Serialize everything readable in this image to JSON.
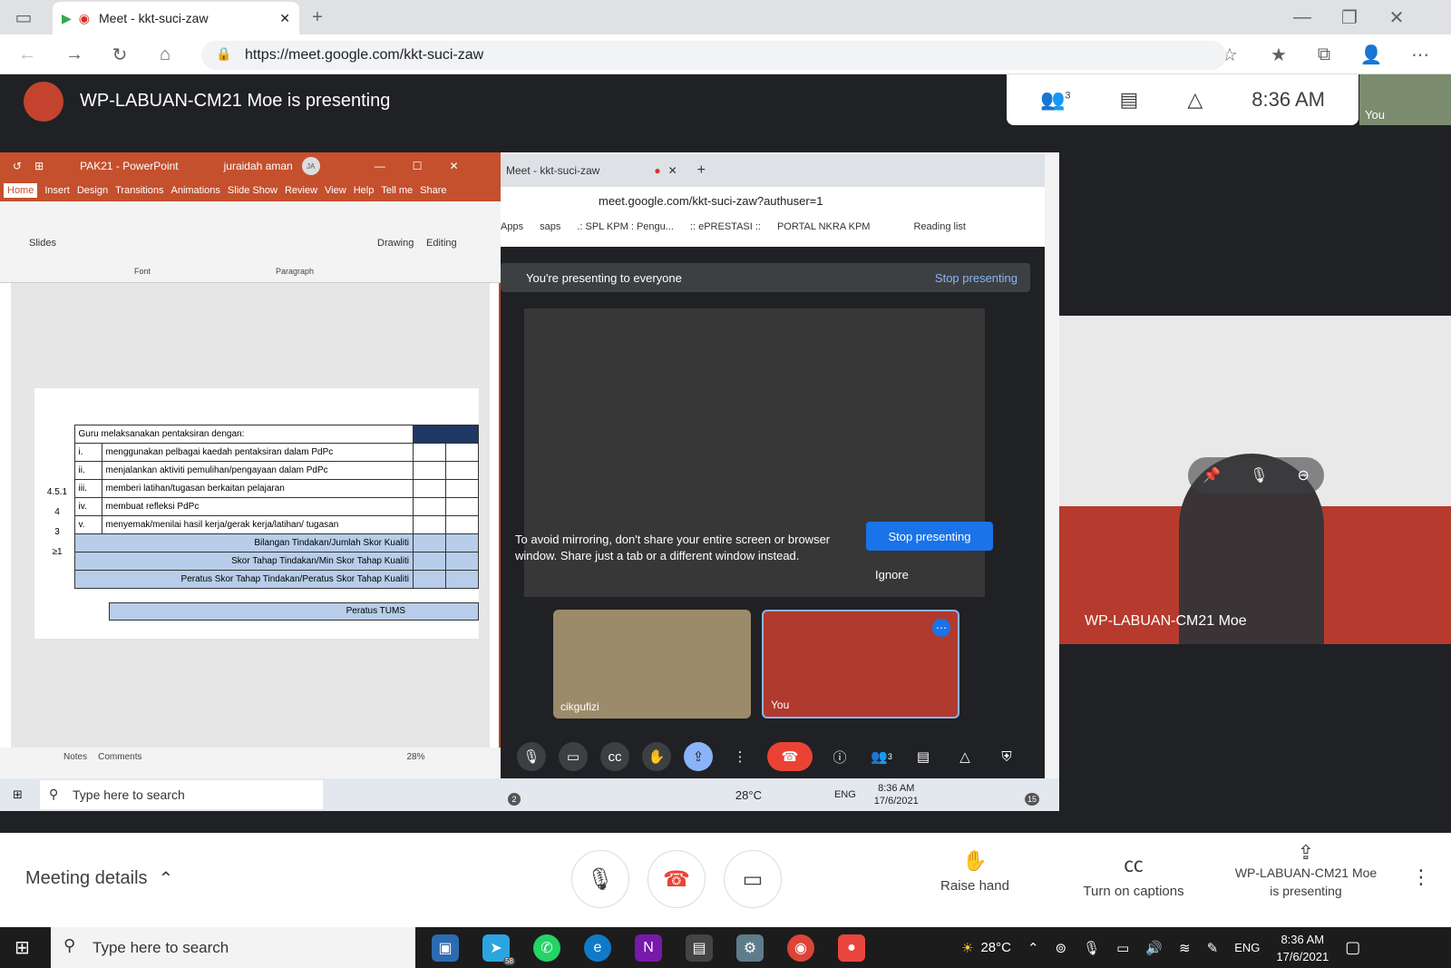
{
  "browser": {
    "tab_title": "Meet - kkt-suci-zaw",
    "url": "https://meet.google.com/kkt-suci-zaw"
  },
  "meet": {
    "presenter_banner": "WP-LABUAN-CM21 Moe is presenting",
    "participant_count": "3",
    "time": "8:36 AM",
    "self_label": "You",
    "big_tile_name": "WP-LABUAN-CM21 Moe"
  },
  "ppt": {
    "title": "PAK21 - PowerPoint",
    "user": "juraidah aman",
    "user_initials": "JA",
    "tabs": [
      "Home",
      "Insert",
      "Design",
      "Transitions",
      "Animations",
      "Slide Show",
      "Review",
      "View",
      "Help",
      "Tell me",
      "Share"
    ],
    "groups": {
      "slides": "Slides",
      "font": "Font",
      "paragraph": "Paragraph",
      "drawing": "Drawing",
      "editing": "Editing"
    },
    "status": {
      "notes": "Notes",
      "comments": "Comments",
      "zoom": "28%"
    },
    "table": {
      "header": "Guru melaksanakan pentaksiran dengan:",
      "code": "4.5.1",
      "scores": [
        "4",
        "3",
        "≥1"
      ],
      "items": [
        {
          "num": "i.",
          "text": "menggunakan pelbagai kaedah pentaksiran dalam PdPc"
        },
        {
          "num": "ii.",
          "text": "menjalankan aktiviti pemulihan/pengayaan dalam PdPc"
        },
        {
          "num": "iii.",
          "text": "memberi latihan/tugasan berkaitan pelajaran"
        },
        {
          "num": "iv.",
          "text": "membuat refleksi PdPc"
        },
        {
          "num": "v.",
          "text": "menyemak/menilai hasil kerja/gerak kerja/latihan/ tugasan"
        }
      ],
      "summary": [
        "Bilangan Tindakan/Jumlah Skor Kualiti",
        "Skor Tahap Tindakan/Min Skor Tahap Kualiti",
        "Peratus Skor Tahap Tindakan/Peratus Skor Tahap Kualiti",
        "Peratus TUMS"
      ]
    }
  },
  "inner": {
    "tab_title": "Meet - kkt-suci-zaw",
    "url": "meet.google.com/kkt-suci-zaw?authuser=1",
    "bookmarks": [
      "Apps",
      "saps",
      ".: SPL KPM : Pengu...",
      ":: ePRESTASI ::",
      "PORTAL NKRA KPM",
      "Reading list"
    ],
    "presenting_text": "You're presenting to everyone",
    "stop_presenting": "Stop presenting",
    "mirror_warning": "To avoid mirroring, don't share your entire screen or browser window. Share just a tab or a different window instead.",
    "stop_button": "Stop presenting",
    "ignore": "Ignore",
    "tile1_name": "cikgufizi",
    "tile2_name": "You",
    "people_badge": "3",
    "taskbar": {
      "search": "Type here to search",
      "temp": "28°C",
      "lang": "ENG",
      "time": "8:36 AM",
      "date": "17/6/2021",
      "mail_badge": "2",
      "notif": "15"
    }
  },
  "bottom": {
    "meeting_details": "Meeting details",
    "raise_hand": "Raise hand",
    "captions": "Turn on captions",
    "presenting_line1": "WP-LABUAN-CM21 Moe",
    "presenting_line2": "is presenting"
  },
  "taskbar": {
    "search": "Type here to search",
    "telegram_badge": "58",
    "temp": "28°C",
    "lang": "ENG",
    "time": "8:36 AM",
    "date": "17/6/2021"
  },
  "colors": {
    "ppt_accent": "#c4502e",
    "meet_blue": "#1a73e8",
    "hangup": "#ea4335",
    "table_blue": "#b7cde9",
    "table_dark": "#1f3864"
  }
}
